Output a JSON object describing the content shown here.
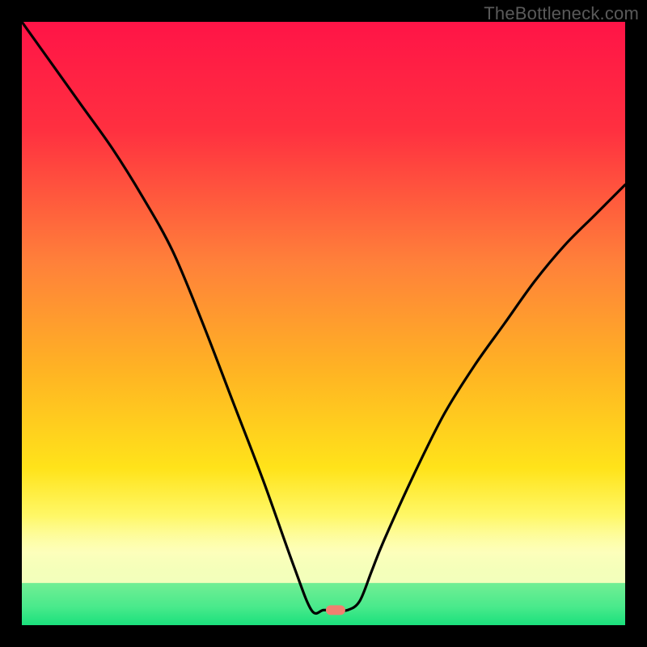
{
  "watermark": "TheBottleneck.com",
  "chart_data": {
    "type": "line",
    "title": "",
    "xlabel": "",
    "ylabel": "",
    "xlim": [
      0,
      100
    ],
    "ylim": [
      0,
      100
    ],
    "grid": false,
    "legend": false,
    "curve": {
      "name": "bottleneck-curve",
      "x": [
        0,
        5,
        10,
        15,
        20,
        25,
        30,
        35,
        40,
        45,
        48,
        50,
        52,
        54,
        56,
        58,
        60,
        65,
        70,
        75,
        80,
        85,
        90,
        95,
        100
      ],
      "y": [
        100,
        93,
        86,
        79,
        71,
        62,
        50,
        37,
        24,
        10,
        2.5,
        2.5,
        2.5,
        2.5,
        4,
        9,
        14,
        25,
        35,
        43,
        50,
        57,
        63,
        68,
        73
      ]
    },
    "green_band": {
      "y0": 0,
      "y1": 7
    },
    "yellow_band": {
      "y0": 7,
      "y1": 18
    },
    "marker": {
      "x": 52,
      "y": 2.5,
      "color": "#f08070"
    },
    "gradient_stops": [
      {
        "offset": 0,
        "color": "#ff1447"
      },
      {
        "offset": 18,
        "color": "#ff3040"
      },
      {
        "offset": 40,
        "color": "#ff813a"
      },
      {
        "offset": 58,
        "color": "#ffb423"
      },
      {
        "offset": 74,
        "color": "#ffe31a"
      },
      {
        "offset": 82,
        "color": "#fff868"
      },
      {
        "offset": 88,
        "color": "#fcffb8"
      },
      {
        "offset": 93,
        "color": "#d8ffb0"
      },
      {
        "offset": 97,
        "color": "#7cf59c"
      },
      {
        "offset": 100,
        "color": "#18e07a"
      }
    ]
  }
}
